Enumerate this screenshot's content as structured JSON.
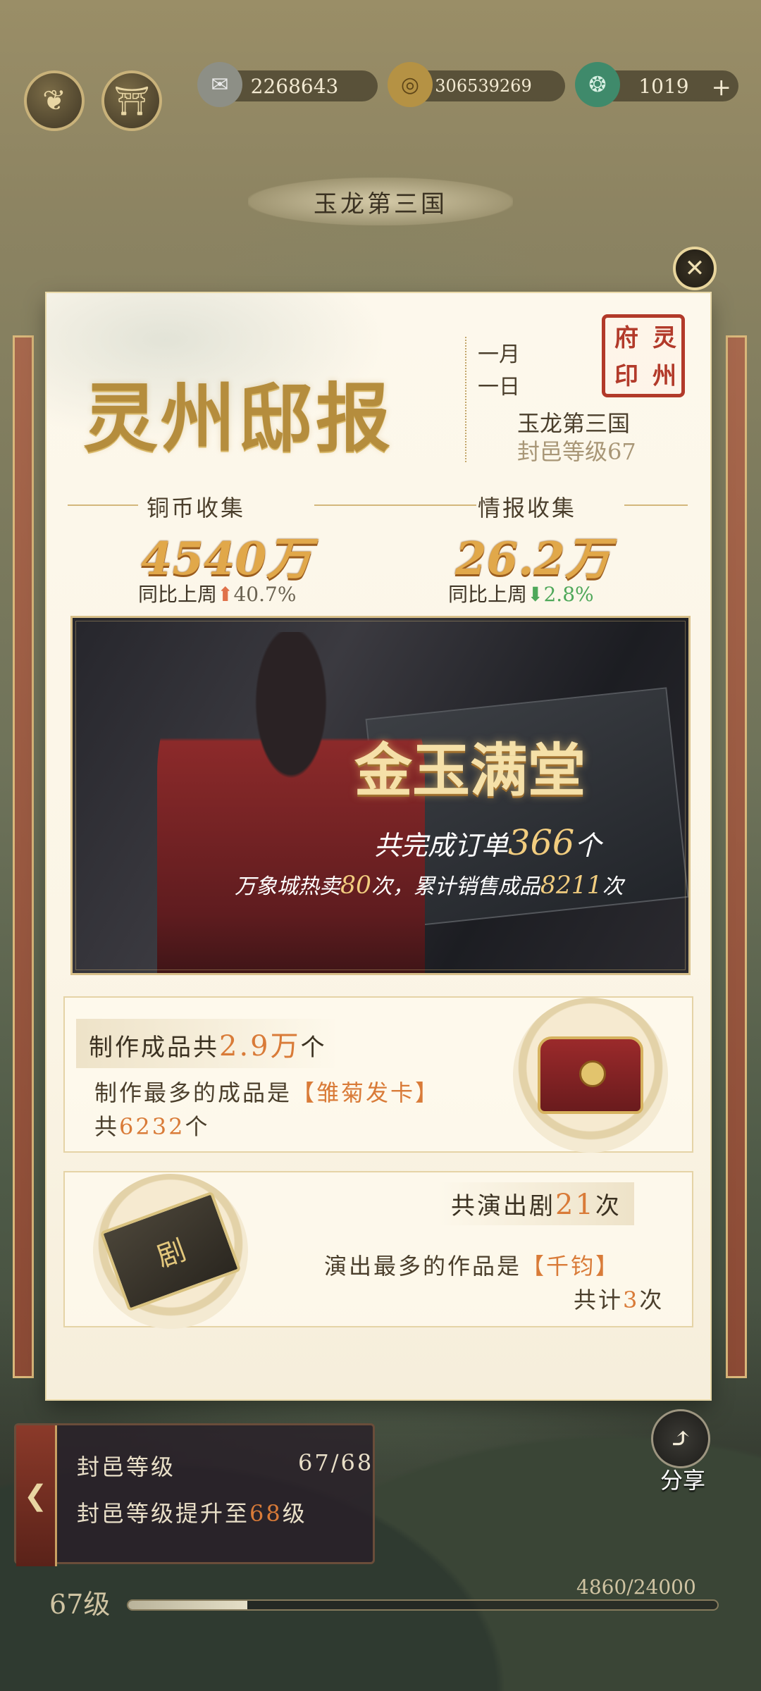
{
  "topbar": {
    "resources": [
      {
        "icon": "scroll-icon",
        "value": "2268643"
      },
      {
        "icon": "copper-coin-icon",
        "value": "306539269"
      },
      {
        "icon": "jade-icon",
        "value": "1019",
        "plus": "+"
      }
    ]
  },
  "page_title": "玉龙第三国",
  "report": {
    "title": "灵州邸报",
    "seal": [
      "灵",
      "州",
      "府",
      "印"
    ],
    "date_month": "一月",
    "date_day": "一日",
    "fief_name": "玉龙第三国",
    "fief_level": "封邑等级67",
    "copper": {
      "label": "铜币收集",
      "value": "4540万",
      "compare_label": "同比上周",
      "trend": "up",
      "percent": "40.7%"
    },
    "intel": {
      "label": "情报收集",
      "value": "26.2万",
      "compare_label": "同比上周",
      "trend": "down",
      "percent": "2.8%"
    },
    "banner": {
      "title": "金玉满堂",
      "line1_prefix": "共完成订单",
      "line1_value": "366",
      "line1_suffix": "个",
      "line2_prefix": "万象城热卖",
      "line2_value1": "80",
      "line2_mid": "次，累计销售成品",
      "line2_value2": "8211",
      "line2_suffix": "次"
    },
    "craft": {
      "title_prefix": "制作成品共",
      "title_value": "2.9万",
      "title_suffix": "个",
      "most_prefix": "制作最多的成品是",
      "most_item": "【雏菊发卡】",
      "count_prefix": "共",
      "count_value": "6232",
      "count_suffix": "个"
    },
    "drama": {
      "title_prefix": "共演出剧",
      "title_value": "21",
      "title_suffix": "次",
      "most_prefix": "演出最多的作品是",
      "most_item": "【千钧】",
      "count_prefix": "共计",
      "count_value": "3",
      "count_suffix": "次",
      "book_label": "剧"
    }
  },
  "hud": {
    "level_label": "封邑等级",
    "level_value": "67/68",
    "upgrade_prefix": "封邑等级提升至",
    "upgrade_value": "68",
    "upgrade_suffix": "级",
    "share_label": "分享",
    "player_level": "67级",
    "xp_text": "4860/24000",
    "xp_progress": 0.2025
  },
  "colors": {
    "gold_title": "#b58d3d",
    "orange_highlight": "#d97b38",
    "trend_up": "#e0724a",
    "trend_down": "#4fa85a"
  }
}
